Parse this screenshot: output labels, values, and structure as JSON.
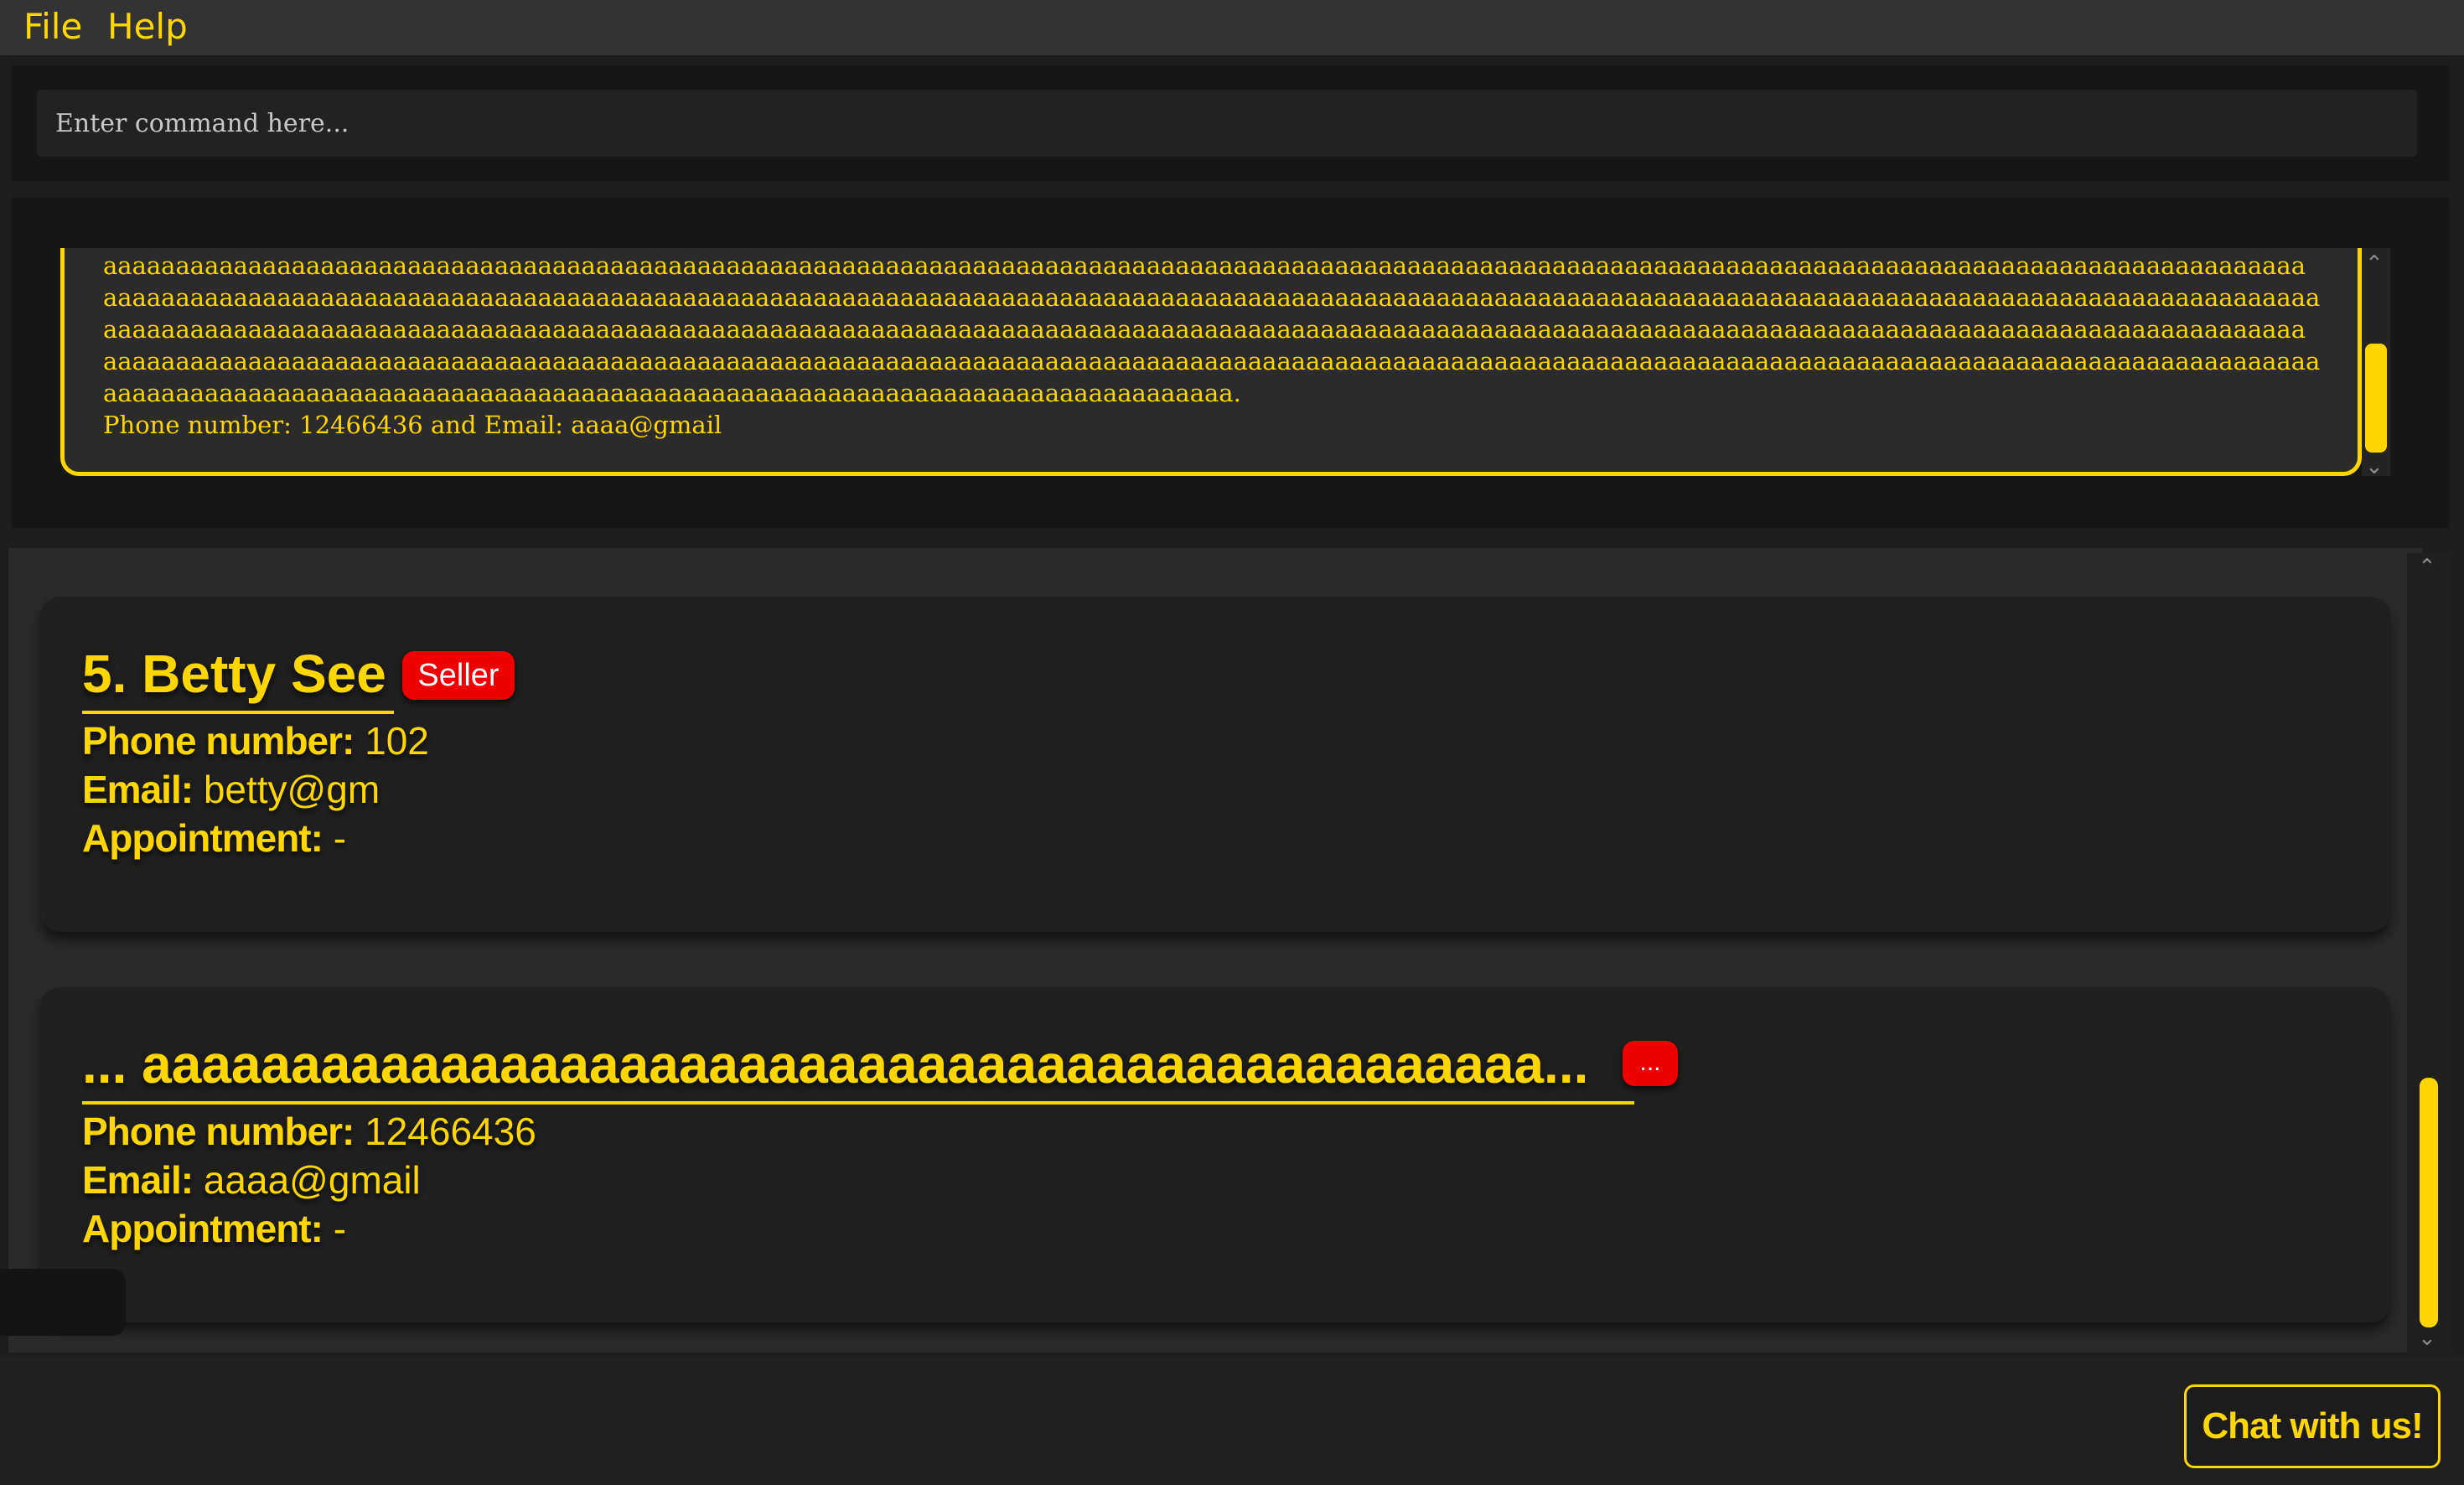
{
  "menu": {
    "file": "File",
    "help": "Help"
  },
  "command": {
    "placeholder": "Enter command here..."
  },
  "result": {
    "text": "aaaaaaaaaaaaaaaaaaaaaaaaaaaaaaaaaaaaaaaaaaaaaaaaaaaaaaaaaaaaaaaaaaaaaaaaaaaaaaaaaaaaaaaaaaaaaaaaaaaaaaaaaaaaaaaaaaaaaaaaaaaaaaaaaaaaaaaaaaaaaaaaaaaaaaaa\naaaaaaaaaaaaaaaaaaaaaaaaaaaaaaaaaaaaaaaaaaaaaaaaaaaaaaaaaaaaaaaaaaaaaaaaaaaaaaaaaaaaaaaaaaaaaaaaaaaaaaaaaaaaaaaaaaaaaaaaaaaaaaaaaaaaaaaaaaaaaaaaaaaaaaaaa\naaaaaaaaaaaaaaaaaaaaaaaaaaaaaaaaaaaaaaaaaaaaaaaaaaaaaaaaaaaaaaaaaaaaaaaaaaaaaaaaaaaaaaaaaaaaaaaaaaaaaaaaaaaaaaaaaaaaaaaaaaaaaaaaaaaaaaaaaaaaaaaaaaaaaaaa\naaaaaaaaaaaaaaaaaaaaaaaaaaaaaaaaaaaaaaaaaaaaaaaaaaaaaaaaaaaaaaaaaaaaaaaaaaaaaaaaaaaaaaaaaaaaaaaaaaaaaaaaaaaaaaaaaaaaaaaaaaaaaaaaaaaaaaaaaaaaaaaaaaaaaaaaa\naaaaaaaaaaaaaaaaaaaaaaaaaaaaaaaaaaaaaaaaaaaaaaaaaaaaaaaaaaaaaaaaaaaaaaaaaaaaaa.\nPhone number: 12466436 and Email: aaaa@gmail"
  },
  "persons": [
    {
      "index": "5.",
      "name": "Betty See",
      "tag": "Seller",
      "phone_label": "Phone number:",
      "phone": "102",
      "email_label": "Email:",
      "email": "betty@gm",
      "appointment_label": "Appointment:",
      "appointment": "-"
    },
    {
      "index": "...",
      "name": "aaaaaaaaaaaaaaaaaaaaaaaaaaaaaaaaaaaaaaaaaaaaaaa...",
      "tag": "...",
      "phone_label": "Phone number:",
      "phone": "12466436",
      "email_label": "Email:",
      "email": "aaaa@gmail",
      "appointment_label": "Appointment:",
      "appointment": "-"
    }
  ],
  "chat": {
    "label": "Chat with us!"
  },
  "colors": {
    "accent": "#ffd600",
    "tag": "#ee0000",
    "background": "#1d1d1d"
  }
}
